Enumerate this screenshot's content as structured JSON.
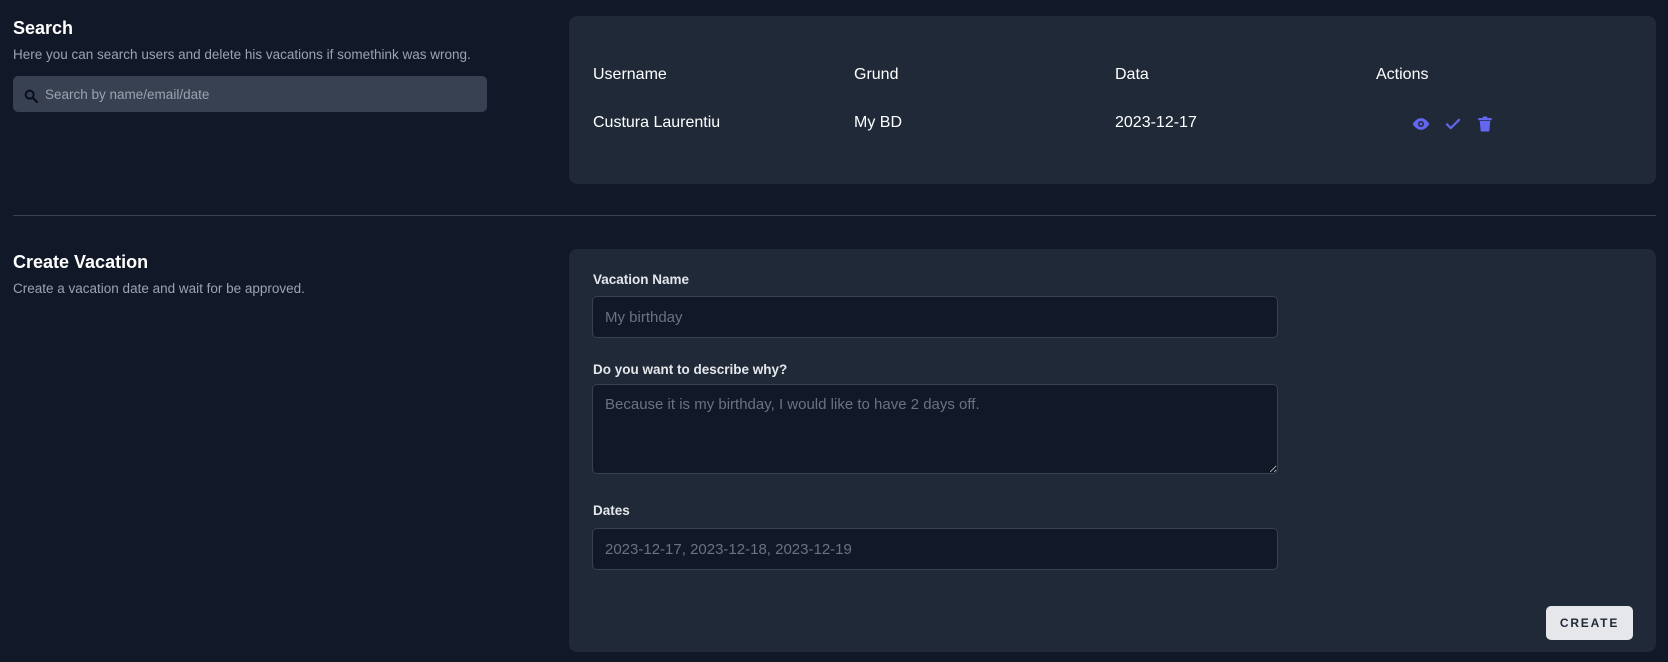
{
  "search": {
    "title": "Search",
    "description": "Here you can search users and delete his vacations if somethink was wrong.",
    "placeholder": "Search by name/email/date",
    "value": "",
    "icon": "search-icon"
  },
  "table": {
    "headers": [
      "Username",
      "Grund",
      "Data",
      "Actions"
    ],
    "rows": [
      {
        "username": "Custura Laurentiu",
        "grund": "My BD",
        "data": "2023-12-17",
        "actions": [
          "eye-icon",
          "check-icon",
          "trash-icon"
        ]
      }
    ]
  },
  "create": {
    "title": "Create Vacation",
    "description": "Create a vacation date and wait for be approved.",
    "name_label": "Vacation Name",
    "name_placeholder": "My birthday",
    "why_label": "Do you want to describe why?",
    "why_placeholder": "Because it is my birthday, I would like to have 2 days off.",
    "dates_label": "Dates",
    "dates_placeholder": "2023-12-17, 2023-12-18, 2023-12-19",
    "button_label": "CREATE"
  },
  "colors": {
    "background": "#111827",
    "card": "#1f2937",
    "accent": "#6366f1",
    "input_bg": "#374151"
  }
}
